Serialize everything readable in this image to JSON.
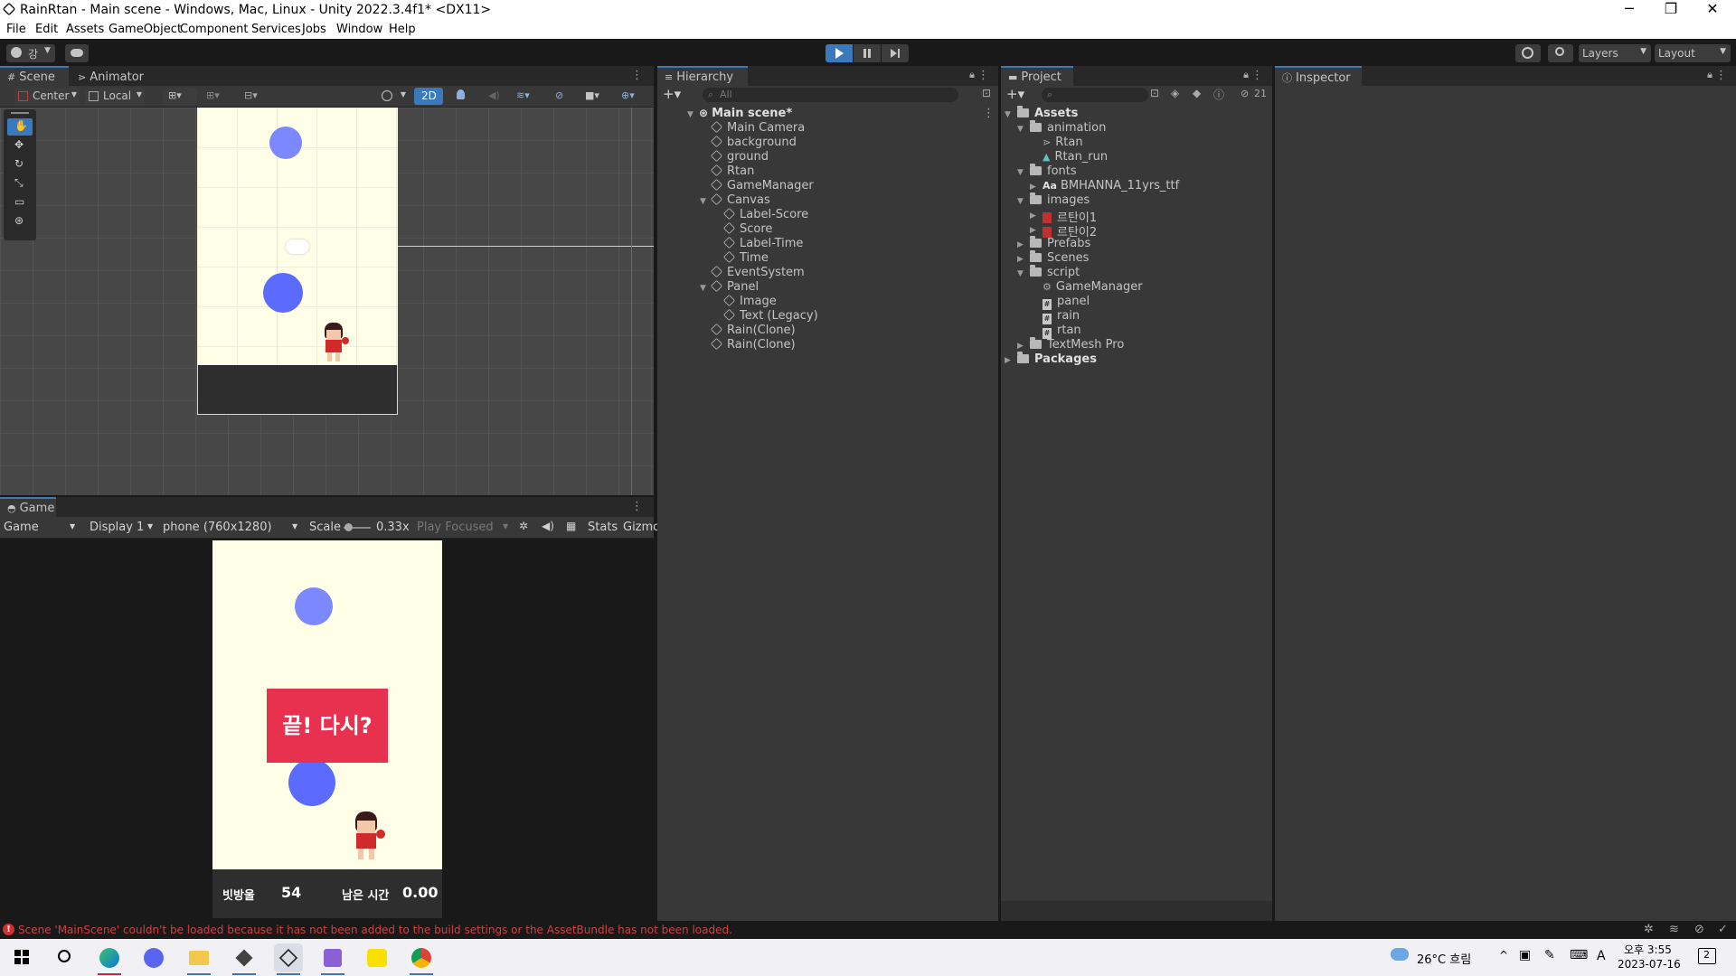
{
  "window": {
    "title": "RainRtan - Main scene - Windows, Mac, Linux - Unity 2022.3.4f1* <DX11>",
    "minimize": "─",
    "maximize": "❐",
    "close": "✕"
  },
  "menu": [
    "File",
    "Edit",
    "Assets",
    "GameObject",
    "Component",
    "Services",
    "Jobs",
    "Window",
    "Help"
  ],
  "toolbar": {
    "account_label": "강",
    "layers_label": "Layers",
    "layout_label": "Layout"
  },
  "scene_panel": {
    "tabs": [
      "Scene",
      "Animator"
    ],
    "center_label": "Center",
    "local_label": "Local",
    "mode_2d": "2D"
  },
  "game_panel": {
    "tab": "Game",
    "view_dropdown": "Game",
    "display": "Display 1",
    "resolution": "phone (760x1280)",
    "scale_label": "Scale",
    "scale_value": "0.33x",
    "play_focused": "Play Focused",
    "stats": "Stats",
    "gizmos": "Gizmo",
    "game_over_text": "끝! 다시?",
    "score_label": "빗방울",
    "score_value": "54",
    "time_label": "남은 시간",
    "time_value": "0.00"
  },
  "hierarchy": {
    "tab": "Hierarchy",
    "search_placeholder": "All",
    "scene_name": "Main scene*",
    "items": [
      {
        "label": "Main Camera"
      },
      {
        "label": "background"
      },
      {
        "label": "ground"
      },
      {
        "label": "Rtan"
      },
      {
        "label": "GameManager"
      },
      {
        "label": "Canvas"
      },
      {
        "label": "Label-Score"
      },
      {
        "label": "Score"
      },
      {
        "label": "Label-Time"
      },
      {
        "label": "Time"
      },
      {
        "label": "EventSystem"
      },
      {
        "label": "Panel"
      },
      {
        "label": "Image"
      },
      {
        "label": "Text (Legacy)"
      },
      {
        "label": "Rain(Clone)"
      },
      {
        "label": "Rain(Clone)"
      }
    ]
  },
  "project": {
    "tab": "Project",
    "hidden_count": "21",
    "items": [
      {
        "label": "Assets"
      },
      {
        "label": "animation"
      },
      {
        "label": "Rtan"
      },
      {
        "label": "Rtan_run"
      },
      {
        "label": "fonts"
      },
      {
        "label": "BMHANNA_11yrs_ttf"
      },
      {
        "label": "images"
      },
      {
        "label": "르탄이1"
      },
      {
        "label": "르탄이2"
      },
      {
        "label": "Prefabs"
      },
      {
        "label": "Scenes"
      },
      {
        "label": "script"
      },
      {
        "label": "GameManager"
      },
      {
        "label": "panel"
      },
      {
        "label": "rain"
      },
      {
        "label": "rtan"
      },
      {
        "label": "TextMesh Pro"
      },
      {
        "label": "Packages"
      }
    ]
  },
  "inspector": {
    "tab": "Inspector"
  },
  "status": {
    "error": "Scene 'MainScene' couldn't be loaded because it has not been added to the build settings or the AssetBundle has not been loaded."
  },
  "taskbar": {
    "weather": "26°C 흐림",
    "time": "오후 3:55",
    "date": "2023-07-16",
    "ime": "A",
    "notifications": "2"
  },
  "colors": {
    "accent": "#3a79bb",
    "game_bg": "#fffee6",
    "rain": "#5b6bff",
    "game_over_box": "#e8314e"
  }
}
